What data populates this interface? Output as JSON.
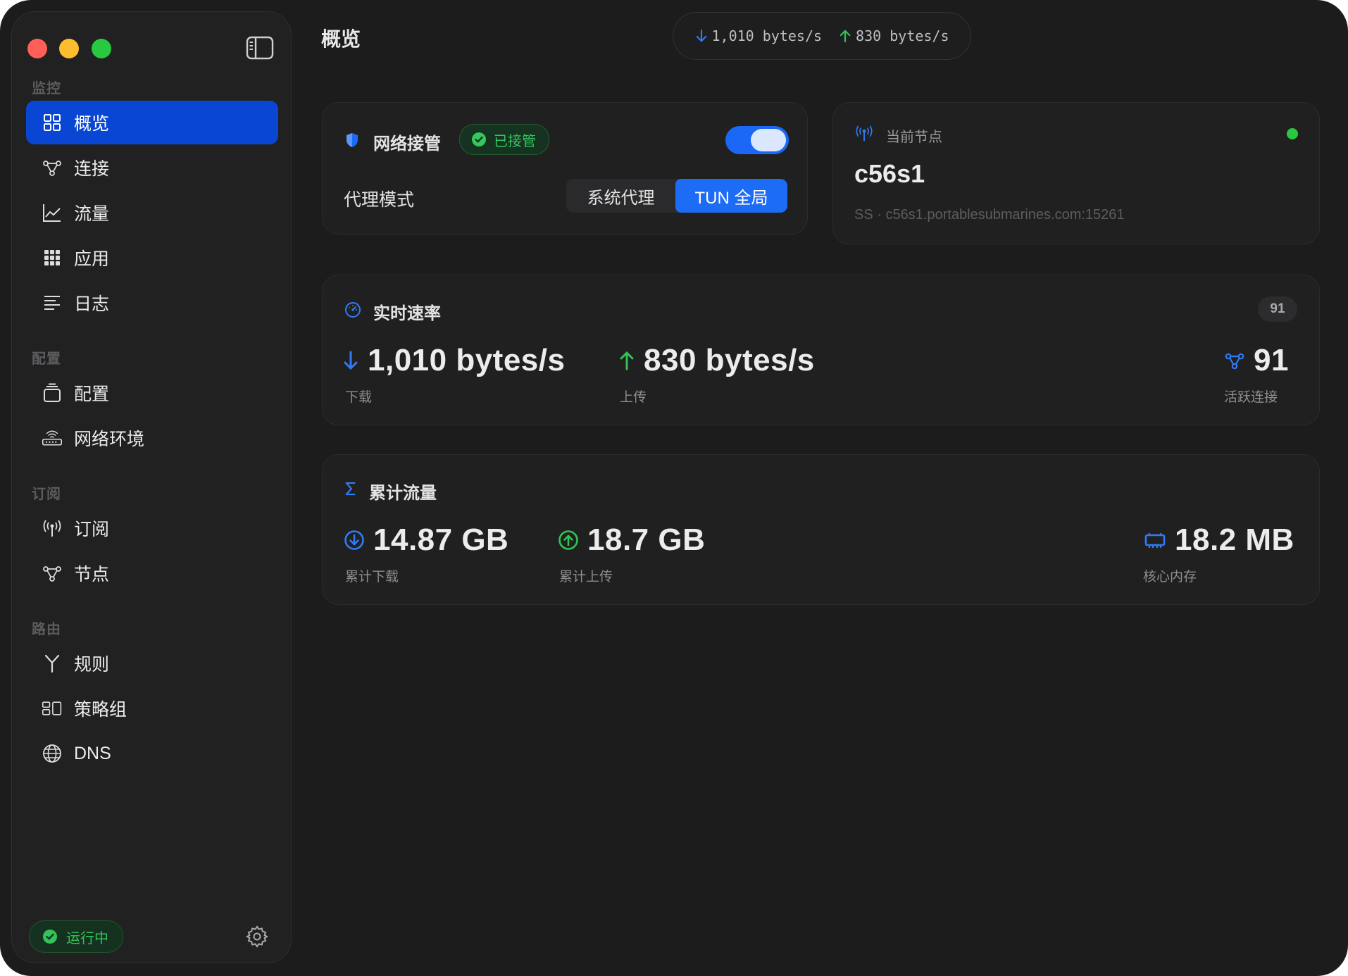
{
  "sidebar": {
    "sections": [
      {
        "label": "监控",
        "items": [
          {
            "label": "概览",
            "icon": "grid-icon",
            "active": true
          },
          {
            "label": "连接",
            "icon": "connections-icon"
          },
          {
            "label": "流量",
            "icon": "chart-line-icon"
          },
          {
            "label": "应用",
            "icon": "apps-icon"
          },
          {
            "label": "日志",
            "icon": "list-icon"
          }
        ]
      },
      {
        "label": "配置",
        "items": [
          {
            "label": "配置",
            "icon": "stack-icon"
          },
          {
            "label": "网络环境",
            "icon": "router-icon"
          }
        ]
      },
      {
        "label": "订阅",
        "items": [
          {
            "label": "订阅",
            "icon": "antenna-icon"
          },
          {
            "label": "节点",
            "icon": "nodes-icon"
          }
        ]
      },
      {
        "label": "路由",
        "items": [
          {
            "label": "规则",
            "icon": "branch-icon"
          },
          {
            "label": "策略组",
            "icon": "group-icon"
          },
          {
            "label": "DNS",
            "icon": "globe-icon"
          }
        ]
      }
    ],
    "status": "运行中"
  },
  "header": {
    "title": "概览",
    "download_speed": "1,010 bytes/s",
    "upload_speed": "830 bytes/s"
  },
  "takeover": {
    "title": "网络接管",
    "badge": "已接管",
    "toggle_on": true,
    "mode_label": "代理模式",
    "modes": [
      "系统代理",
      "TUN 全局"
    ],
    "selected_mode": "TUN 全局"
  },
  "node": {
    "label": "当前节点",
    "name": "c56s1",
    "detail": "SS · c56s1.portablesubmarines.com:15261",
    "status_color": "#28c840"
  },
  "realtime": {
    "title": "实时速率",
    "count_badge": "91",
    "download": {
      "value": "1,010 bytes/s",
      "label": "下载"
    },
    "upload": {
      "value": "830 bytes/s",
      "label": "上传"
    },
    "active": {
      "value": "91",
      "label": "活跃连接"
    }
  },
  "cumulative": {
    "title": "累计流量",
    "download": {
      "value": "14.87 GB",
      "label": "累计下载"
    },
    "upload": {
      "value": "18.7 GB",
      "label": "累计上传"
    },
    "memory": {
      "value": "18.2 MB",
      "label": "核心内存"
    }
  },
  "colors": {
    "accent": "#1d6cf6",
    "active_nav": "#0a46d4",
    "download_blue": "#2f7bf6",
    "upload_green": "#30c454",
    "status_green": "#33c35a"
  }
}
